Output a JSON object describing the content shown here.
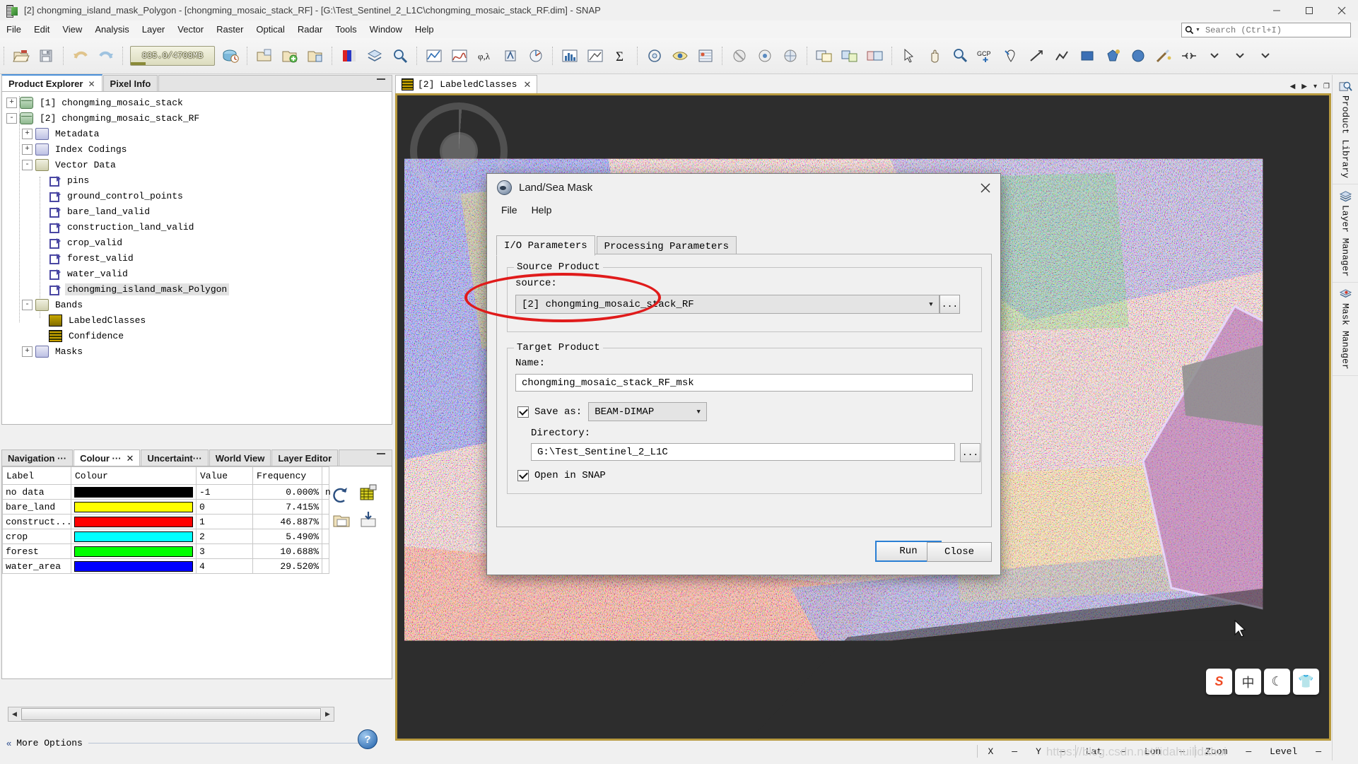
{
  "window": {
    "title": "[2] chongming_island_mask_Polygon - [chongming_mosaic_stack_RF] - [G:\\Test_Sentinel_2_L1C\\chongming_mosaic_stack_RF.dim] - SNAP",
    "minimize_label": "–",
    "maximize_label": "❐",
    "close_label": "✕"
  },
  "menu": {
    "items": [
      "File",
      "Edit",
      "View",
      "Analysis",
      "Layer",
      "Vector",
      "Raster",
      "Optical",
      "Radar",
      "Tools",
      "Window",
      "Help"
    ],
    "search_placeholder": "Search (Ctrl+I)",
    "search_value": ""
  },
  "toolbar": {
    "memory_text": "835.0/4708MB",
    "memory_percent": 18,
    "icons": [
      "open-product-icon",
      "save-product-icon",
      "undo-icon",
      "redo-icon",
      "refresh-memory-icon",
      "open-rgb-icon",
      "open-folder-green-icon",
      "open-folder-blue-icon",
      "colour-manipulation-icon",
      "layer-icon",
      "magnifier-icon",
      "profile-plot-icon",
      "spectrum-icon",
      "geo-coding-icon",
      "information-icon",
      "statistics-icon",
      "histogram-icon",
      "scatter-plot-icon",
      "sum-icon",
      "mask-icon",
      "mask-area-icon",
      "pin-manager-icon",
      "no-data-icon",
      "gcp-manager-icon",
      "gcp-icon",
      "subset-icon",
      "zoom-all-icon",
      "zoom-tool-icon",
      "selection-tool-icon",
      "pan-tool-icon",
      "zoom-icon",
      "gcp-placing-icon",
      "pin-placing-icon",
      "line-drawing-icon",
      "polyline-drawing-icon",
      "rectangle-drawing-icon",
      "polygon-drawing-icon",
      "ellipse-drawing-icon",
      "magic-wand-icon",
      "range-finder-icon",
      "more-tools-icon"
    ]
  },
  "left_panel": {
    "tabs": [
      {
        "label": "Product Explorer",
        "closable": true,
        "active": true
      },
      {
        "label": "Pixel Info",
        "closable": false,
        "active": false
      }
    ],
    "minimize_label": "–",
    "tree": [
      {
        "label": "[1] chongming_mosaic_stack",
        "depth": 0,
        "expander": "+",
        "icon": "product-icon",
        "selected": false
      },
      {
        "label": "[2] chongming_mosaic_stack_RF",
        "depth": 0,
        "expander": "-",
        "icon": "product-icon",
        "selected": false
      },
      {
        "label": "Metadata",
        "depth": 1,
        "expander": "+",
        "icon": "folder-icon",
        "selected": false
      },
      {
        "label": "Index Codings",
        "depth": 1,
        "expander": "+",
        "icon": "folder-icon",
        "selected": false
      },
      {
        "label": "Vector Data",
        "depth": 1,
        "expander": "-",
        "icon": "folder-open-icon",
        "selected": false
      },
      {
        "label": "pins",
        "depth": 2,
        "expander": "",
        "icon": "vector-icon",
        "selected": false
      },
      {
        "label": "ground_control_points",
        "depth": 2,
        "expander": "",
        "icon": "vector-icon",
        "selected": false
      },
      {
        "label": "bare_land_valid",
        "depth": 2,
        "expander": "",
        "icon": "vector-icon",
        "selected": false
      },
      {
        "label": "construction_land_valid",
        "depth": 2,
        "expander": "",
        "icon": "vector-icon",
        "selected": false
      },
      {
        "label": "crop_valid",
        "depth": 2,
        "expander": "",
        "icon": "vector-icon",
        "selected": false
      },
      {
        "label": "forest_valid",
        "depth": 2,
        "expander": "",
        "icon": "vector-icon",
        "selected": false
      },
      {
        "label": "water_valid",
        "depth": 2,
        "expander": "",
        "icon": "vector-icon",
        "selected": false
      },
      {
        "label": "chongming_island_mask_Polygon",
        "depth": 2,
        "expander": "",
        "icon": "vector-icon",
        "selected": true
      },
      {
        "label": "Bands",
        "depth": 1,
        "expander": "-",
        "icon": "folder-open-icon",
        "selected": false
      },
      {
        "label": "LabeledClasses",
        "depth": 2,
        "expander": "",
        "icon": "band-icon",
        "selected": false
      },
      {
        "label": "Confidence",
        "depth": 2,
        "expander": "",
        "icon": "band-icon",
        "selected": false
      },
      {
        "label": "Masks",
        "depth": 1,
        "expander": "+",
        "icon": "folder-icon",
        "selected": false
      }
    ]
  },
  "colour_panel": {
    "tabs": [
      {
        "label": "Navigation ···",
        "closable": false,
        "active": false
      },
      {
        "label": "Colour ···",
        "closable": true,
        "active": true
      },
      {
        "label": "Uncertaint···",
        "closable": false,
        "active": false
      },
      {
        "label": "World View",
        "closable": false,
        "active": false
      },
      {
        "label": "Layer Editor",
        "closable": false,
        "active": false
      }
    ],
    "minimize_label": "–",
    "table": {
      "headers": [
        "Label",
        "Colour",
        "Value",
        "Frequency",
        ""
      ],
      "rows": [
        {
          "label": "no data",
          "colour": "#000000",
          "value": "-1",
          "frequency": "0.000%"
        },
        {
          "label": "bare_land",
          "colour": "#ffff00",
          "value": "0",
          "frequency": "7.415%"
        },
        {
          "label": "construct...",
          "colour": "#ff0000",
          "value": "1",
          "frequency": "46.887%"
        },
        {
          "label": "crop",
          "colour": "#00ffff",
          "value": "2",
          "frequency": "5.490%"
        },
        {
          "label": "forest",
          "colour": "#00ff00",
          "value": "3",
          "frequency": "10.688%"
        },
        {
          "label": "water_area",
          "colour": "#0000ff",
          "value": "4",
          "frequency": "29.520%"
        }
      ],
      "extra_cell_text": "n"
    },
    "side_icons": [
      "reset-icon",
      "multi-assign-icon",
      "import-palette-icon",
      "export-palette-icon"
    ],
    "more_options_label": "More Options",
    "more_options_chevron": "«",
    "help_label": "?",
    "scroll_left": "◀",
    "scroll_right": "▶"
  },
  "view": {
    "tab_label": "[2] LabeledClasses",
    "tab_close": "✕",
    "tab_controls": [
      "◀",
      "▶",
      "▾",
      "❐"
    ],
    "status": {
      "x_label": "X",
      "x_value": "—",
      "y_label": "Y",
      "y_value": "—",
      "lat_label": "Lat",
      "lat_value": "—",
      "lon_label": "Lon",
      "lon_value": "—",
      "zoom_label": "Zoom",
      "zoom_value": "—",
      "level_label": "Level",
      "level_value": "—"
    },
    "watermark": "https://blog.csdn.net/lidahuilidahui",
    "ime_keys": [
      "S",
      "中",
      "☽",
      "▼"
    ]
  },
  "right_dock": {
    "items": [
      {
        "label": "Product Library",
        "icon": "product-library-icon"
      },
      {
        "label": "Layer Manager",
        "icon": "layer-manager-icon"
      },
      {
        "label": "Mask Manager",
        "icon": "mask-manager-icon"
      }
    ]
  },
  "dialog": {
    "title": "Land/Sea Mask",
    "close_label": "✕",
    "menu": [
      "File",
      "Help"
    ],
    "tabs": [
      {
        "label": "I/O Parameters",
        "active": true
      },
      {
        "label": "Processing Parameters",
        "active": false
      }
    ],
    "source_group": {
      "legend": "Source Product",
      "source_label": "source:",
      "source_value": "[2] chongming_mosaic_stack_RF",
      "browse_label": "...",
      "dropdown_arrow": "⌄"
    },
    "target_group": {
      "legend": "Target Product",
      "name_label": "Name:",
      "name_value": "chongming_mosaic_stack_RF_msk",
      "save_as_label": "Save as:",
      "save_as_checked": true,
      "format_value": "BEAM-DIMAP",
      "format_arrow": "⌄",
      "directory_label": "Directory:",
      "directory_value": "G:\\Test_Sentinel_2_L1C",
      "directory_browse_label": "...",
      "open_in_snap_label": "Open in SNAP",
      "open_in_snap_checked": true
    },
    "buttons": {
      "run": "Run",
      "close": "Close"
    },
    "highlight_color": "#e01b1b"
  }
}
